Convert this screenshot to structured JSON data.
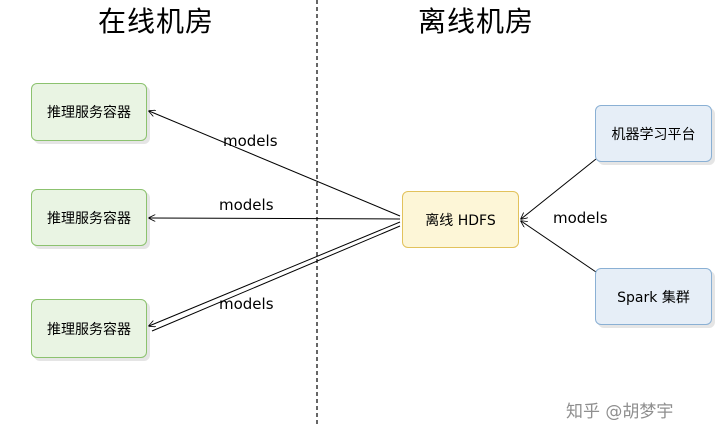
{
  "zones": {
    "online_title": "在线机房",
    "offline_title": "离线机房"
  },
  "nodes": {
    "inference_1": "推理服务容器",
    "inference_2": "推理服务容器",
    "inference_3": "推理服务容器",
    "hdfs": "离线 HDFS",
    "ml_platform": "机器学习平台",
    "spark": "Spark 集群"
  },
  "edges": {
    "label_1": "models",
    "label_2": "models",
    "label_3": "models",
    "label_4": "models"
  },
  "watermark": "知乎 @胡梦宇",
  "colors": {
    "online_node_fill": "#e9f4e3",
    "online_node_border": "#8cc26f",
    "hdfs_fill": "#fdf6d7",
    "hdfs_border": "#e2c25c",
    "source_fill": "#e6eef7",
    "source_border": "#8ab0d4"
  }
}
